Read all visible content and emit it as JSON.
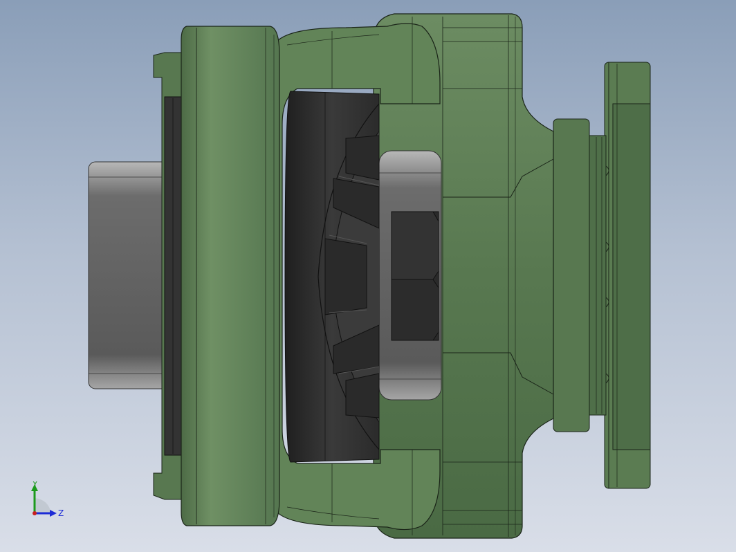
{
  "viewport": {
    "background_top": "#8a9eb8",
    "background_bottom": "#d9dee8"
  },
  "model": {
    "housing_color": "#5e7f54",
    "housing_dark": "#3f5c3a",
    "housing_light": "#7a9a6c",
    "rubber_color": "#2f2f2f",
    "shaft_color": "#6e6e6e",
    "nut_color": "#262626",
    "edge_color": "#1a2418"
  },
  "triad": {
    "y_label": "Y",
    "z_label": "Z",
    "y_color": "#1c9a1c",
    "z_color": "#1c2bd6",
    "origin_color": "#c81e1e"
  }
}
